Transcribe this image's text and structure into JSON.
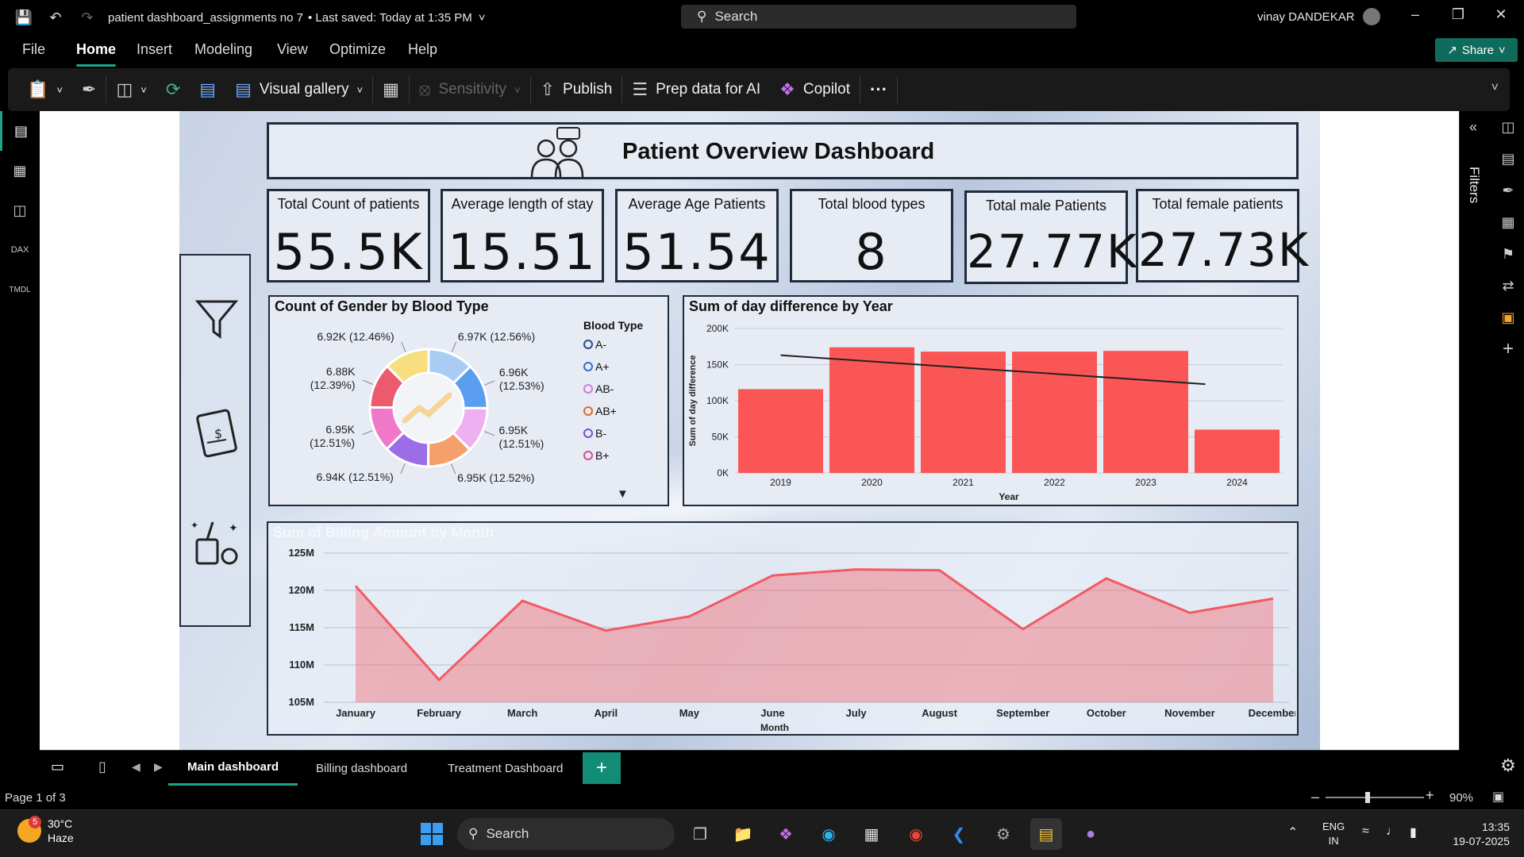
{
  "window": {
    "title": "patient dashboard_assignments no 7",
    "saved": "• Last saved: Today at 1:35 PM",
    "search_placeholder": "Search",
    "user": "vinay DANDEKAR",
    "share_label": "Share"
  },
  "menu": [
    "File",
    "Home",
    "Insert",
    "Modeling",
    "View",
    "Optimize",
    "Help"
  ],
  "ribbon": {
    "visual_gallery": "Visual gallery",
    "sensitivity": "Sensitivity",
    "publish": "Publish",
    "prep_data": "Prep data for AI",
    "copilot": "Copilot",
    "more": "···"
  },
  "dashboard": {
    "title": "Patient Overview Dashboard",
    "kpis": [
      {
        "label": "Total Count of patients",
        "value": "55.5K"
      },
      {
        "label": "Average length of stay",
        "value": "15.51"
      },
      {
        "label": "Average Age Patients",
        "value": "51.54"
      },
      {
        "label": "Total blood types",
        "value": "8"
      },
      {
        "label": "Total male Patients",
        "value": "27.77K"
      },
      {
        "label": "Total female patients",
        "value": "27.73K"
      }
    ]
  },
  "filters_label": "Filters",
  "chart_data": [
    {
      "type": "pie",
      "title": "Count of Gender by Blood Type",
      "legend_title": "Blood Type",
      "legend": [
        "A-",
        "A+",
        "AB-",
        "AB+",
        "B-",
        "B+"
      ],
      "slices": [
        {
          "label": "6.97K (12.56%)",
          "value": 6970,
          "color": "#a9ccf5"
        },
        {
          "label": "6.96K (12.53%)",
          "value": 6960,
          "color": "#5b9ef0"
        },
        {
          "label": "6.95K (12.51%)",
          "value": 6950,
          "color": "#eeb0f0"
        },
        {
          "label": "6.95K (12.52%)",
          "value": 6950,
          "color": "#f5a06a"
        },
        {
          "label": "6.94K (12.51%)",
          "value": 6940,
          "color": "#9b6ee8"
        },
        {
          "label": "6.95K (12.51%)",
          "value": 6950,
          "color": "#ef79c8"
        },
        {
          "label": "6.88K (12.39%)",
          "value": 6880,
          "color": "#ec5a6e"
        },
        {
          "label": "6.92K (12.46%)",
          "value": 6920,
          "color": "#f7de7e"
        }
      ],
      "legend_colors": [
        "#1f4e8c",
        "#2d6fd0",
        "#d57ad8",
        "#e06a2a",
        "#7b4fd0",
        "#d84a9b"
      ]
    },
    {
      "type": "bar",
      "title": "Sum of day difference by Year",
      "categories": [
        "2019",
        "2020",
        "2021",
        "2022",
        "2023",
        "2024"
      ],
      "values": [
        116000,
        174000,
        168000,
        168000,
        169000,
        60000
      ],
      "trend": [
        163000,
        123000
      ],
      "xlabel": "Year",
      "ylabel": "Sum of day difference",
      "yticks": [
        "0K",
        "50K",
        "100K",
        "150K",
        "200K"
      ],
      "ylim": [
        0,
        200000
      ],
      "color": "#fb5656"
    },
    {
      "type": "area",
      "title": "Sum of Billing Amount by Month",
      "categories": [
        "January",
        "February",
        "March",
        "April",
        "May",
        "June",
        "July",
        "August",
        "September",
        "October",
        "November",
        "December"
      ],
      "values": [
        120.6,
        108,
        118.6,
        114.6,
        116.5,
        122,
        122.8,
        122.7,
        114.8,
        121.6,
        117,
        118.9
      ],
      "xlabel": "Month",
      "ylabel": "Sum of Billing Amount",
      "yticks": [
        "105M",
        "110M",
        "115M",
        "120M",
        "125M"
      ],
      "ylim": [
        105,
        125
      ],
      "color": "#f25a64"
    }
  ],
  "tabs": [
    "Main dashboard",
    "Billing dashboard",
    "Treatment Dashboard"
  ],
  "status": {
    "page": "Page 1 of 3",
    "zoom": "90%"
  },
  "taskbar": {
    "weather_temp": "30°C",
    "weather_desc": "Haze",
    "search": "Search",
    "lang1": "ENG",
    "lang2": "IN",
    "time": "13:35",
    "date": "19-07-2025",
    "badge": "5"
  }
}
